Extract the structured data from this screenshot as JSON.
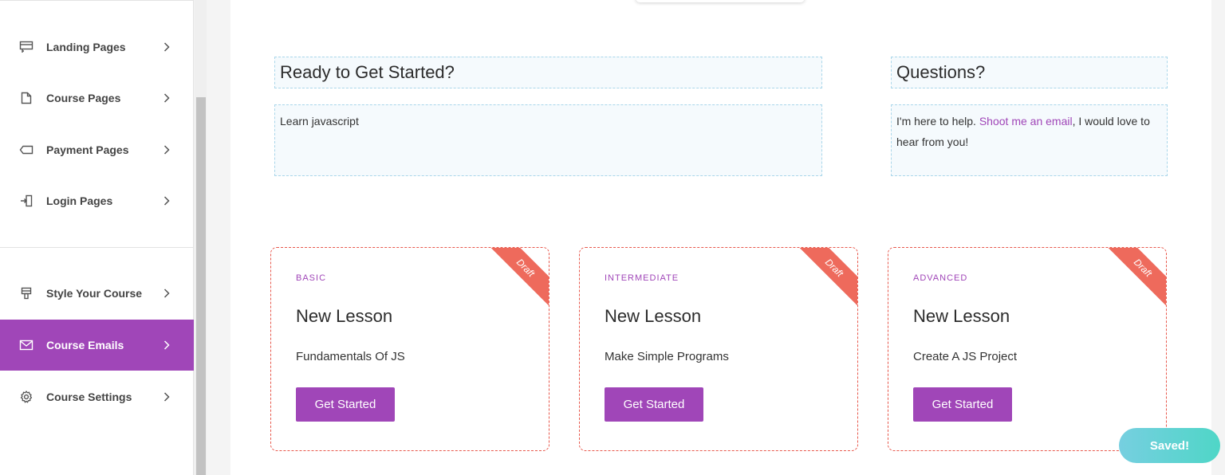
{
  "sidebar": {
    "items": [
      {
        "label": "Landing Pages",
        "icon": "landing-page-icon"
      },
      {
        "label": "Course Pages",
        "icon": "document-icon"
      },
      {
        "label": "Payment Pages",
        "icon": "tag-icon"
      },
      {
        "label": "Login Pages",
        "icon": "login-icon"
      },
      {
        "label": "Style Your Course",
        "icon": "paintbrush-icon"
      },
      {
        "label": "Course Emails",
        "icon": "envelope-icon",
        "active": true
      },
      {
        "label": "Course Settings",
        "icon": "gear-icon"
      }
    ]
  },
  "main": {
    "ready_heading": "Ready to Get Started?",
    "ready_text": "Learn javascript",
    "questions_heading": "Questions?",
    "questions_text_before": "I'm here to help. ",
    "questions_link": "Shoot me an email",
    "questions_text_after": ", I would love to hear from you!",
    "cards": [
      {
        "level": "BASIC",
        "title": "New Lesson",
        "description": "Fundamentals Of JS",
        "button": "Get Started",
        "ribbon": "Draft"
      },
      {
        "level": "INTERMEDIATE",
        "title": "New Lesson",
        "description": "Make Simple Programs",
        "button": "Get Started",
        "ribbon": "Draft"
      },
      {
        "level": "ADVANCED",
        "title": "New Lesson",
        "description": "Create A JS Project",
        "button": "Get Started",
        "ribbon": "Draft"
      }
    ]
  },
  "toast": {
    "label": "Saved!"
  },
  "colors": {
    "accent": "#a046b8",
    "draft": "#ee6a5c",
    "toast_start": "#76cfe0",
    "toast_end": "#4fd6c7"
  }
}
